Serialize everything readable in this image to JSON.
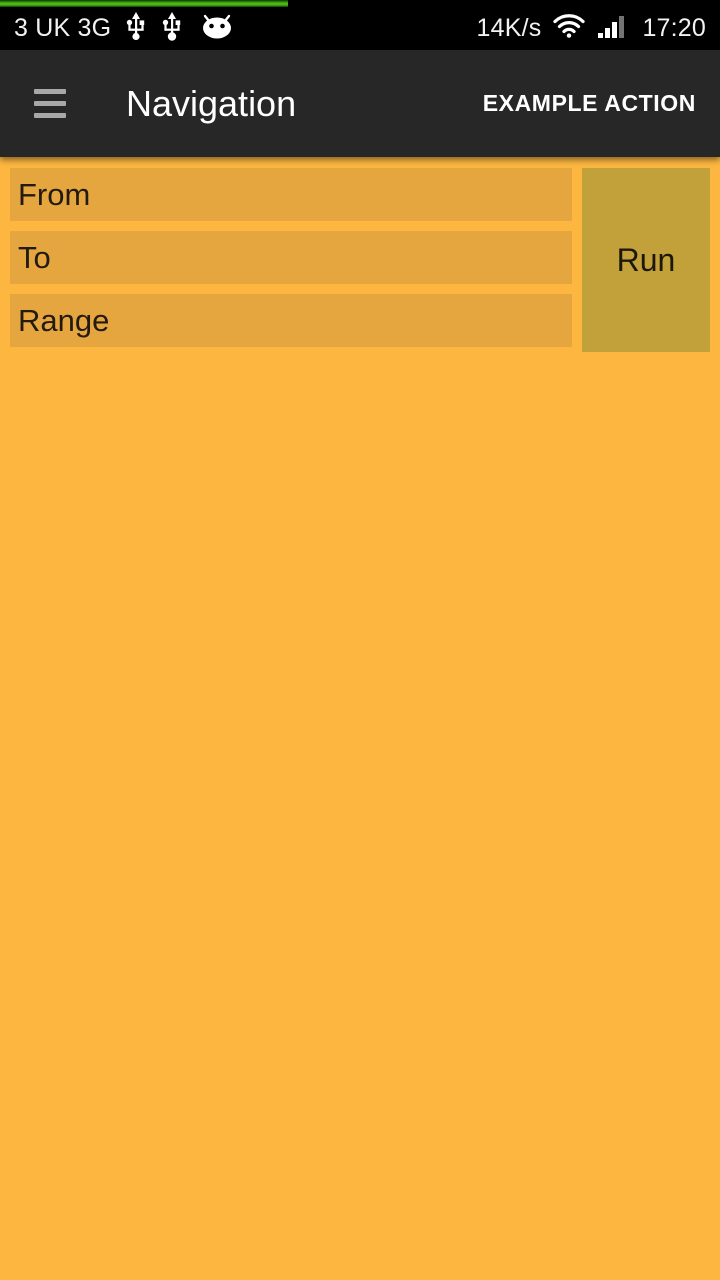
{
  "status_bar": {
    "carrier": "3 UK 3G",
    "network_speed": "14K/s",
    "clock": "17:20",
    "icons": [
      "usb-icon",
      "usb-icon",
      "android-head-icon",
      "wifi-icon",
      "cellular-signal-icon"
    ],
    "background_color": "#000000",
    "text_color": "#f2f2f2"
  },
  "progress_bar": {
    "name": "indeterminate-progress-bar",
    "percent": 40,
    "color": "#59c41a",
    "track_color": "#000000"
  },
  "action_bar": {
    "menu_icon": "hamburger-menu-icon",
    "title": "Navigation",
    "action_label": "EXAMPLE ACTION",
    "background_color": "#272727",
    "title_color": "#ffffff"
  },
  "content": {
    "background_color": "#FDB740",
    "field_background_color": "#E5A63F",
    "field_text_color": "#231a10",
    "fields": [
      {
        "name": "from-input",
        "value": "From",
        "placeholder": "From"
      },
      {
        "name": "to-input",
        "value": "To",
        "placeholder": "To"
      },
      {
        "name": "range-input",
        "value": "Range",
        "placeholder": "Range"
      }
    ],
    "run_button": {
      "label": "Run",
      "background_color": "#C2A03A",
      "text_color": "#1d1708"
    }
  }
}
